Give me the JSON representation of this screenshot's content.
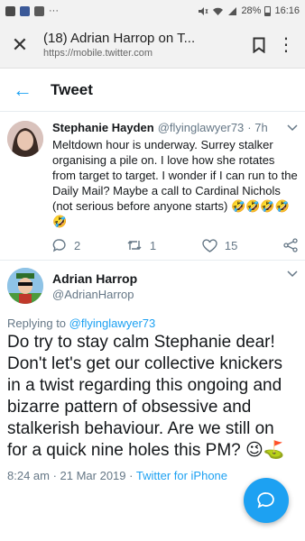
{
  "status_bar": {
    "battery": "28%",
    "time": "16:16",
    "overflow": "···"
  },
  "browser": {
    "title": "(18) Adrian Harrop on T...",
    "url": "https://mobile.twitter.com",
    "close_icon": "✕",
    "menu_icon": "⋮"
  },
  "header": {
    "title": "Tweet",
    "back_icon": "←"
  },
  "parent_tweet": {
    "name": "Stephanie Hayden",
    "handle": "@flyinglawyer73",
    "time": "· 7h",
    "text": "Meltdown hour is underway. Surrey stalker organising a pile on. I love how she rotates from target to target. I wonder if I can run to the Daily Mail? Maybe a call to Cardinal Nichols (not serious before anyone starts) 🤣🤣🤣🤣🤣",
    "replies": "2",
    "retweets": "1",
    "likes": "15"
  },
  "main_tweet": {
    "name": "Adrian Harrop",
    "handle": "@AdrianHarrop",
    "replying_label": "Replying to",
    "replying_to": "@flyinglawyer73",
    "text": "Do try to stay calm Stephanie dear! Don't let's get our collective knickers in a twist regarding this ongoing and bizarre pattern of obsessive and stalkerish behaviour. Are we still on for a quick nine holes this PM? 😉⛳",
    "timestamp": "8:24 am · 21 Mar 2019 ·",
    "source": "Twitter for iPhone"
  },
  "colors": {
    "accent": "#1da1f2",
    "muted": "#657786",
    "text": "#14171a"
  }
}
